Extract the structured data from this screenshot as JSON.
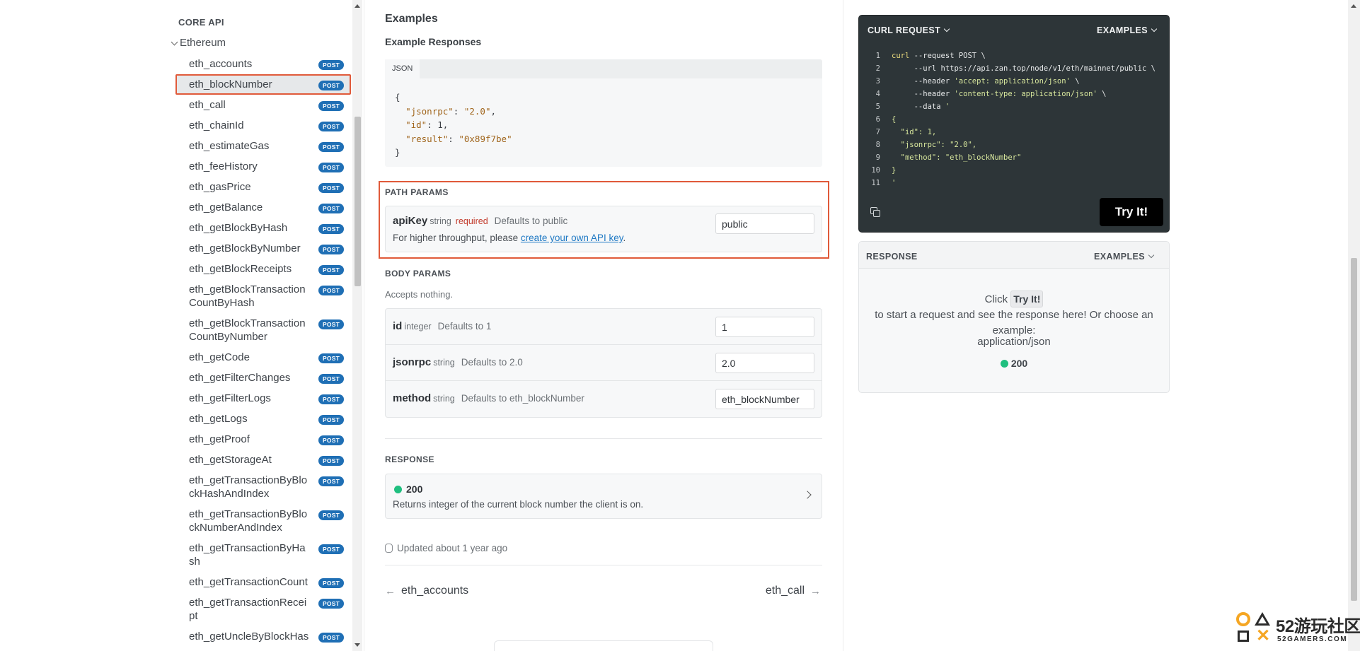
{
  "sidebar": {
    "section_title": "CORE API",
    "group_title": "Ethereum",
    "badge_label": "POST",
    "items": [
      {
        "label": "eth_accounts"
      },
      {
        "label": "eth_blockNumber",
        "active": true
      },
      {
        "label": "eth_call"
      },
      {
        "label": "eth_chainId"
      },
      {
        "label": "eth_estimateGas"
      },
      {
        "label": "eth_feeHistory"
      },
      {
        "label": "eth_gasPrice"
      },
      {
        "label": "eth_getBalance"
      },
      {
        "label": "eth_getBlockByHash"
      },
      {
        "label": "eth_getBlockByNumber"
      },
      {
        "label": "eth_getBlockReceipts"
      },
      {
        "label": "eth_getBlockTransactionCountByHash"
      },
      {
        "label": "eth_getBlockTransactionCountByNumber"
      },
      {
        "label": "eth_getCode"
      },
      {
        "label": "eth_getFilterChanges"
      },
      {
        "label": "eth_getFilterLogs"
      },
      {
        "label": "eth_getLogs"
      },
      {
        "label": "eth_getProof"
      },
      {
        "label": "eth_getStorageAt"
      },
      {
        "label": "eth_getTransactionByBlockHashAndIndex"
      },
      {
        "label": "eth_getTransactionByBlockNumberAndIndex"
      },
      {
        "label": "eth_getTransactionByHash"
      },
      {
        "label": "eth_getTransactionCount"
      },
      {
        "label": "eth_getTransactionReceipt"
      },
      {
        "label": "eth_getUncleByBlockHas"
      }
    ]
  },
  "main": {
    "examples_title": "Examples",
    "example_responses_title": "Example Responses",
    "code_tab": "JSON",
    "json_response": {
      "open": "{",
      "jsonrpc_key": "\"jsonrpc\"",
      "jsonrpc_val": "\"2.0\"",
      "id_key": "\"id\"",
      "id_val": "1",
      "result_key": "\"result\"",
      "result_val": "\"0x89f7be\"",
      "close": "}"
    },
    "path_params": {
      "title": "PATH PARAMS",
      "name": "apiKey",
      "type": "string",
      "required": "required",
      "default": "Defaults to public",
      "value": "public",
      "desc_prefix": "For higher throughput, please ",
      "desc_link": "create your own API key",
      "desc_suffix": "."
    },
    "body_params": {
      "title": "BODY PARAMS",
      "accepts": "Accepts nothing.",
      "rows": [
        {
          "name": "id",
          "type": "integer",
          "default": "Defaults to 1",
          "value": "1"
        },
        {
          "name": "jsonrpc",
          "type": "string",
          "default": "Defaults to 2.0",
          "value": "2.0"
        },
        {
          "name": "method",
          "type": "string",
          "default": "Defaults to eth_blockNumber",
          "value": "eth_blockNumber"
        }
      ]
    },
    "response": {
      "title": "RESPONSE",
      "status": "200",
      "description": "Returns integer of the current block number the client is on."
    },
    "updated": "Updated about 1 year ago",
    "prev": "eth_accounts",
    "next": "eth_call"
  },
  "right": {
    "curl": {
      "title": "CURL REQUEST",
      "examples": "EXAMPLES",
      "lines": [
        {
          "n": "1",
          "kw": "curl",
          "rest": " --request POST \\"
        },
        {
          "n": "2",
          "kw": "",
          "rest": "     --url https://api.zan.top/node/v1/eth/mainnet/public \\"
        },
        {
          "n": "3",
          "kw": "",
          "rest": "     --header ",
          "str": "'accept: application/json'",
          "tail": " \\"
        },
        {
          "n": "4",
          "kw": "",
          "rest": "     --header ",
          "str": "'content-type: application/json'",
          "tail": " \\"
        },
        {
          "n": "5",
          "kw": "",
          "rest": "     --data ",
          "str": "'",
          "tail": ""
        },
        {
          "n": "6",
          "kw": "",
          "rest": "",
          "str": "{",
          "tail": ""
        },
        {
          "n": "7",
          "kw": "",
          "rest": "",
          "str": "  \"id\": 1,",
          "tail": ""
        },
        {
          "n": "8",
          "kw": "",
          "rest": "",
          "str": "  \"jsonrpc\": \"2.0\",",
          "tail": ""
        },
        {
          "n": "9",
          "kw": "",
          "rest": "",
          "str": "  \"method\": \"eth_blockNumber\"",
          "tail": ""
        },
        {
          "n": "10",
          "kw": "",
          "rest": "",
          "str": "}",
          "tail": ""
        },
        {
          "n": "11",
          "kw": "",
          "rest": "",
          "str": "'",
          "tail": ""
        }
      ],
      "try_label": "Try It!"
    },
    "response": {
      "title": "RESPONSE",
      "examples": "EXAMPLES",
      "msg_prefix": "Click ",
      "msg_kbd": "Try It!",
      "msg_suffix": " to start a request and see the response here! Or choose an example:",
      "type": "application/json",
      "status": "200"
    }
  },
  "watermark": {
    "brand": "52游玩社区",
    "sub": "52GAMERS.COM"
  },
  "colors": {
    "accent_highlight": "#e05a3a",
    "post_badge": "#1f6fb5",
    "status_ok": "#1fbf7f",
    "curl_bg": "#2d3538"
  }
}
